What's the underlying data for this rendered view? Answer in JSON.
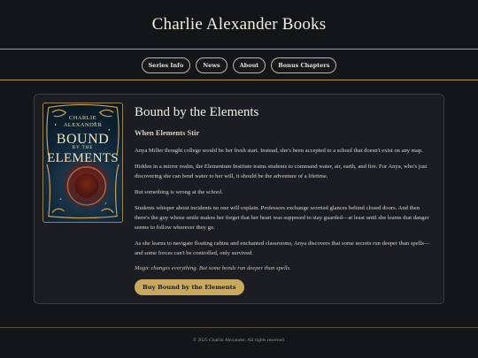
{
  "site": {
    "title": "Charlie Alexander Books"
  },
  "nav": {
    "items": [
      {
        "label": "Series Info"
      },
      {
        "label": "News"
      },
      {
        "label": "About"
      },
      {
        "label": "Bonus Chapters"
      }
    ]
  },
  "book": {
    "cover": {
      "author": [
        "CHARLIE",
        "ALEXANDER"
      ],
      "title_line1": "BOUND",
      "title_line2": "BY THE",
      "title_line3": "ELEMENTS"
    },
    "title": "Bound by the Elements",
    "subtitle": "When Elements Stir",
    "paragraphs": [
      "Anya Miller thought college would be her fresh start. Instead, she's been accepted to a school that doesn't exist on any map.",
      "Hidden in a mirror realm, the Elementum Institute trains students to command water, air, earth, and fire. For Anya, who's just discovering she can bend water to her will, it should be the adventure of a lifetime.",
      "But something is wrong at the school.",
      "Students whisper about incidents no one will explain. Professors exchange worried glances behind closed doors. And then there's the guy whose smile makes her forget that her heart was supposed to stay guarded—at least until she learns that danger seems to follow wherever they go.",
      "As she learns to navigate floating cabins and enchanted classrooms, Anya discovers that some secrets run deeper than spells—and some forces can't be controlled, only survived."
    ],
    "tagline": "Magic changes everything. But some bonds run deeper than spells.",
    "buy_label": "Buy Bound by the Elements"
  },
  "footer": {
    "text": "© 2025 Charlie Alexander. All rights reserved."
  },
  "colors": {
    "accent": "#c9a95e",
    "divider": "#b4975a",
    "background": "#141519",
    "card": "#1b1d23"
  }
}
